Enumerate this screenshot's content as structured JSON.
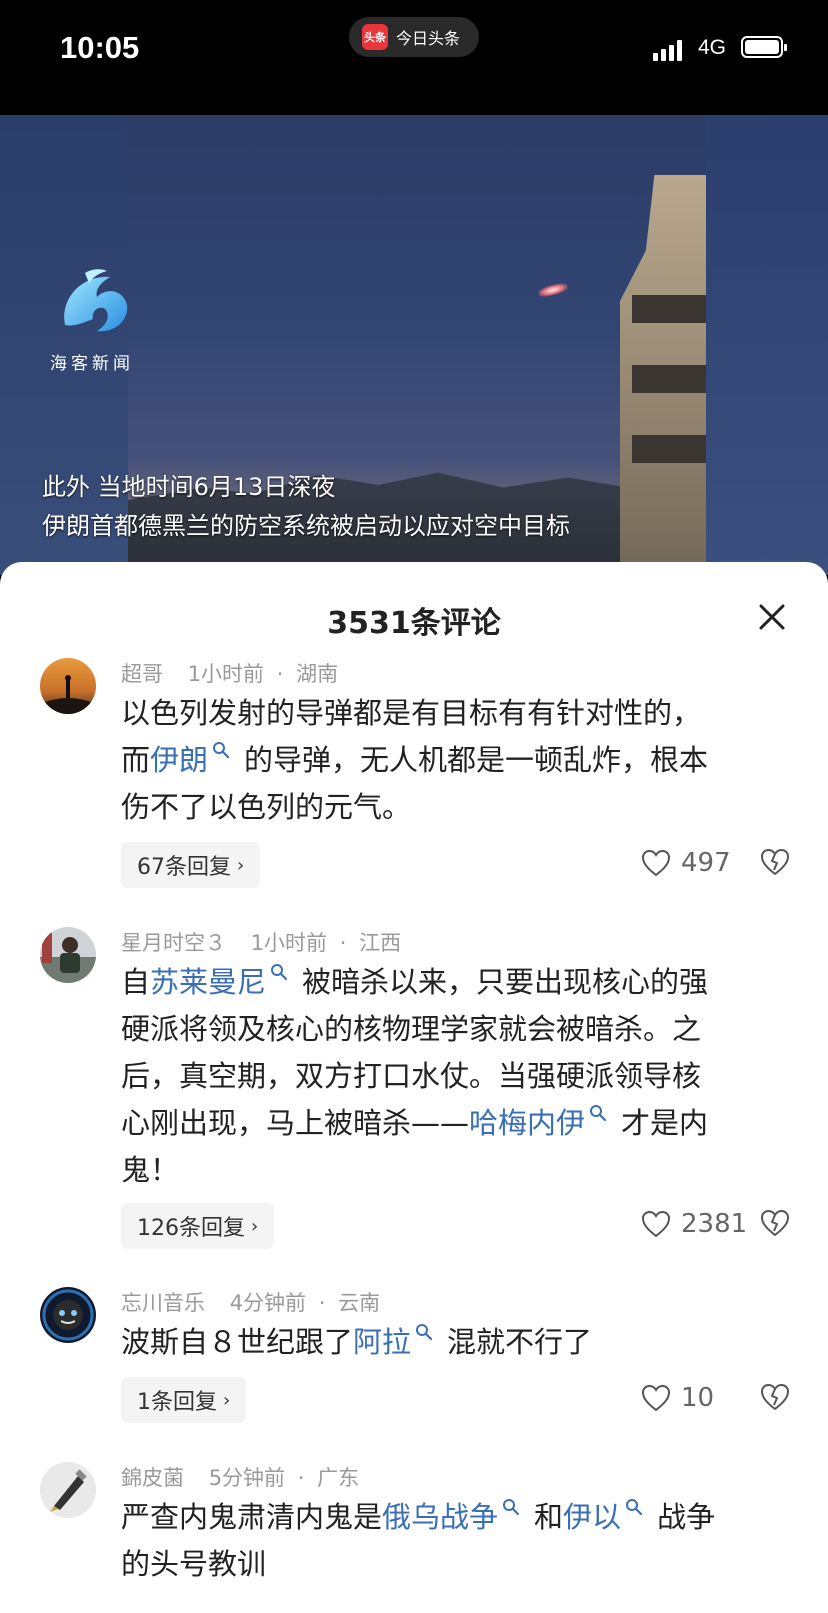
{
  "status_bar": {
    "time": "10:05",
    "network": "4G"
  },
  "dynamic_island": {
    "app_logo_text": "头条",
    "app_name": "今日头条"
  },
  "video": {
    "watermark": "海客新闻",
    "subtitles": [
      "此外  当地时间6月13日深夜",
      "伊朗首都德黑兰的防空系统被启动以应对空中目标"
    ]
  },
  "comments_panel": {
    "title": "3531条评论",
    "close_icon": "close-icon",
    "comments": [
      {
        "user": "超哥",
        "time": "1小时前",
        "location": "湖南",
        "lines": [
          "以色列发射的导弹都是有目标有有针对性的，",
          "而|伊朗|的导弹，无人机都是一顿乱炸，根本",
          "伤不了以色列的元气。"
        ],
        "replies": "67条回复",
        "likes": "497"
      },
      {
        "user": "星月时空３",
        "time": "1小时前",
        "location": "江西",
        "lines": [
          "自|苏莱曼尼|被暗杀以来，只要出现核心的强",
          "硬派将领及核心的核物理学家就会被暗杀。之",
          "后，真空期，双方打口水仗。当强硬派领导核",
          "心刚出现，马上被暗杀——|哈梅内伊|才是内",
          "鬼！"
        ],
        "replies": "126条回复",
        "likes": "2381"
      },
      {
        "user": "忘川音乐",
        "time": "4分钟前",
        "location": "云南",
        "lines": [
          "波斯自８世纪跟了|阿拉|混就不行了"
        ],
        "replies": "1条回复",
        "likes": "10"
      },
      {
        "user": "錦皮菌",
        "time": "5分钟前",
        "location": "广东",
        "lines": [
          "严查内鬼肃清内鬼是|俄乌战争|和|伊以|战争",
          "的头号教训"
        ]
      }
    ],
    "separator": "·",
    "link_color": "#3a6fb3"
  }
}
